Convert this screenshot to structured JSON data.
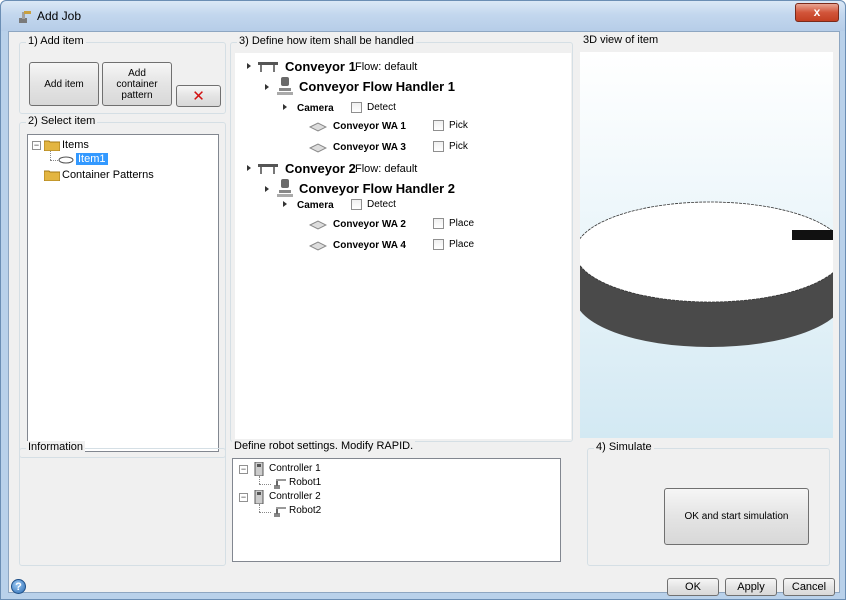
{
  "window": {
    "title": "Add Job",
    "close_glyph": "x"
  },
  "add_item": {
    "group_label": "1) Add item",
    "add_item_label": "Add item",
    "add_container_label": "Add container pattern",
    "delete_glyph": "✕"
  },
  "select_item": {
    "group_label": "2) Select item",
    "tree": {
      "items_label": "Items",
      "item1_label": "Item1",
      "container_patterns_label": "Container Patterns"
    }
  },
  "information": {
    "group_label": "Information"
  },
  "handling": {
    "group_label": "3) Define how item shall be handled",
    "conveyors": [
      {
        "name": "Conveyor 1",
        "flow": "Flow: default",
        "handler": "Conveyor Flow Handler 1",
        "camera": "Camera",
        "detect": "Detect",
        "work_areas": [
          {
            "name": "Conveyor WA 1",
            "action": "Pick"
          },
          {
            "name": "Conveyor WA 3",
            "action": "Pick"
          }
        ]
      },
      {
        "name": "Conveyor 2",
        "flow": "Flow: default",
        "handler": "Conveyor Flow Handler 2",
        "camera": "Camera",
        "detect": "Detect",
        "work_areas": [
          {
            "name": "Conveyor WA 2",
            "action": "Place"
          },
          {
            "name": "Conveyor WA 4",
            "action": "Place"
          }
        ]
      }
    ]
  },
  "view3d": {
    "group_label": "3D view of item",
    "sky_color": "#d9ecf6"
  },
  "robot_settings": {
    "group_label": "Define robot settings. Modify RAPID.",
    "tree": [
      {
        "controller": "Controller 1",
        "robot": "Robot1"
      },
      {
        "controller": "Controller 2",
        "robot": "Robot2"
      }
    ]
  },
  "simulate": {
    "group_label": "4) Simulate",
    "button_label": "OK and start simulation"
  },
  "footer": {
    "ok": "OK",
    "apply": "Apply",
    "cancel": "Cancel",
    "help_glyph": "?"
  }
}
